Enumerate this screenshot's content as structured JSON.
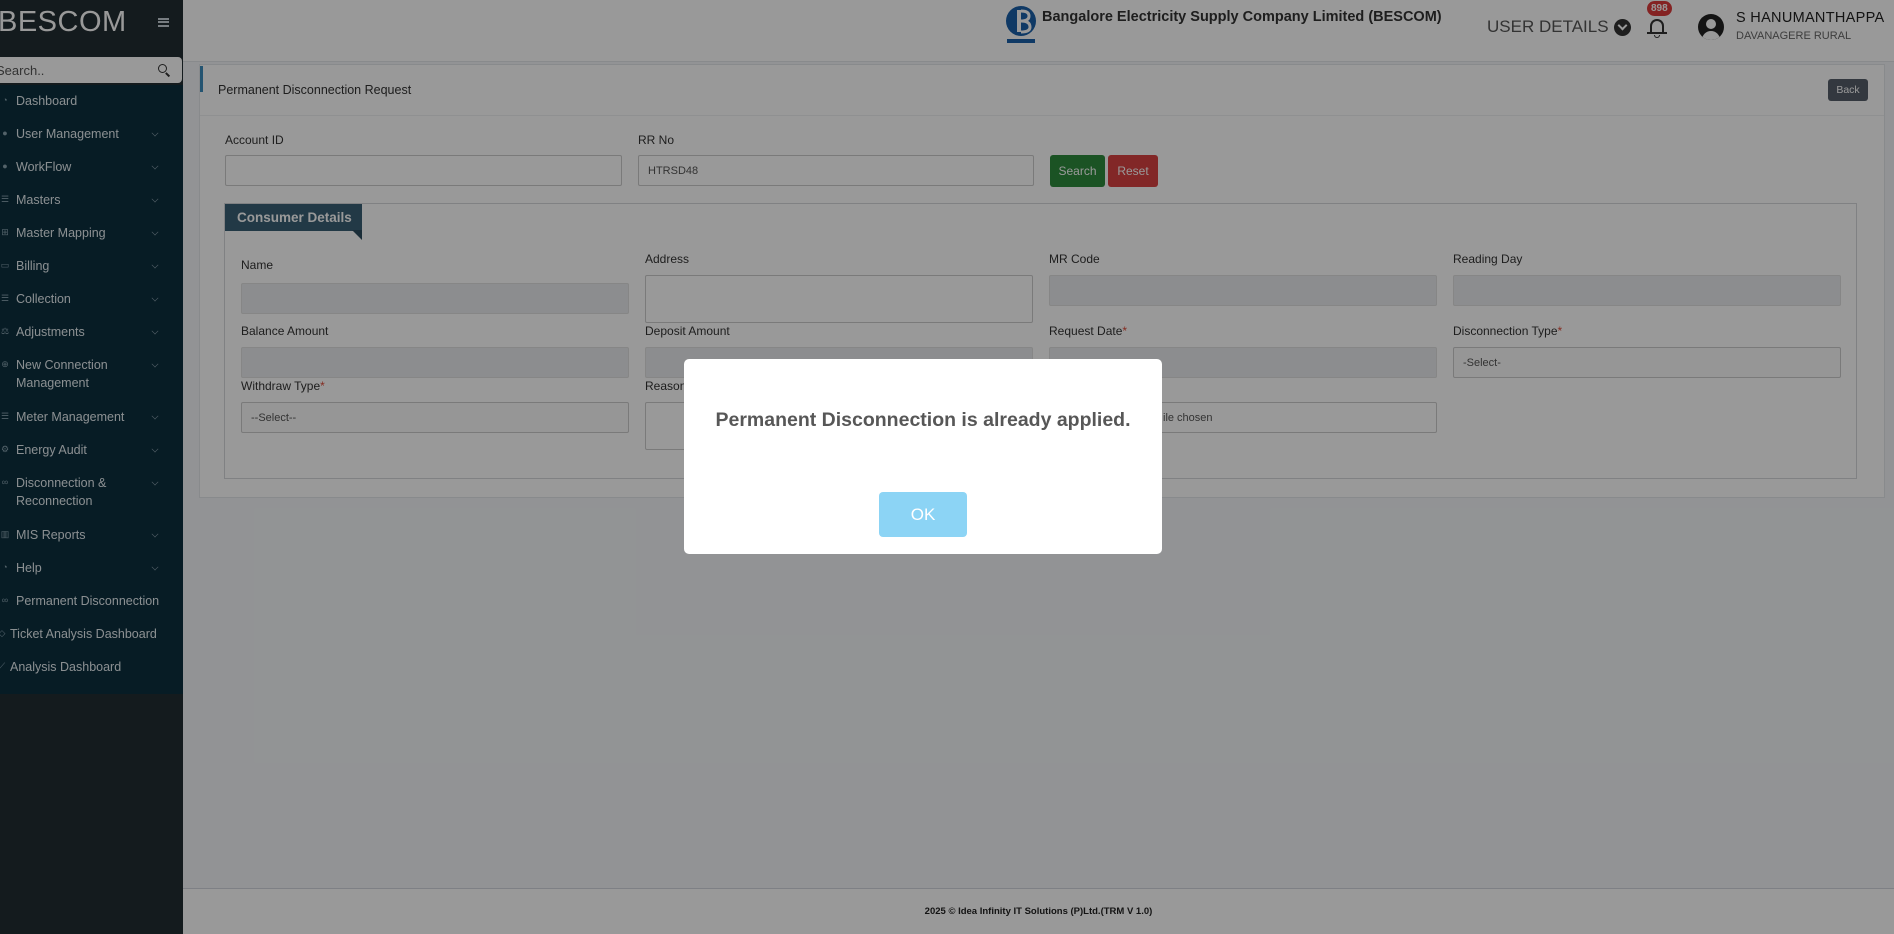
{
  "brand": {
    "title": "BESCOM"
  },
  "sidebar": {
    "search_placeholder": "Search..",
    "items": [
      {
        "label": "Dashboard",
        "icon": "dashboard-icon",
        "has_children": false
      },
      {
        "label": "User Management",
        "icon": "user-icon",
        "has_children": true
      },
      {
        "label": "WorkFlow",
        "icon": "user-icon",
        "has_children": true
      },
      {
        "label": "Masters",
        "icon": "list-icon",
        "has_children": true
      },
      {
        "label": "Master Mapping",
        "icon": "sitemap-icon",
        "has_children": true
      },
      {
        "label": "Billing",
        "icon": "monitor-icon",
        "has_children": true
      },
      {
        "label": "Collection",
        "icon": "list-icon",
        "has_children": true
      },
      {
        "label": "Adjustments",
        "icon": "balance-icon",
        "has_children": true
      },
      {
        "label": "New Connection Management",
        "icon": "plus-circle-icon",
        "has_children": true
      },
      {
        "label": "Meter Management",
        "icon": "list-icon",
        "has_children": true
      },
      {
        "label": "Energy Audit",
        "icon": "cogs-icon",
        "has_children": true
      },
      {
        "label": "Disconnection & Reconnection",
        "icon": "link-icon",
        "has_children": true
      },
      {
        "label": "MIS Reports",
        "icon": "bar-chart-icon",
        "has_children": true
      },
      {
        "label": "Help",
        "icon": "dashboard-icon",
        "has_children": true
      },
      {
        "label": "Permanent Disconnection",
        "icon": "link-icon",
        "has_children": false
      },
      {
        "label": "Ticket Analysis Dashboard",
        "icon": "ticket-icon",
        "has_children": false
      },
      {
        "label": "Analysis Dashboard",
        "icon": "line-chart-icon",
        "has_children": false
      }
    ]
  },
  "header": {
    "company": "Bangalore Electricity Supply Company Limited (BESCOM)",
    "user_details_label": "USER DETAILS",
    "notification_count": "898",
    "user_name": "S HANUMANTHAPPA",
    "user_region": "DAVANAGERE RURAL"
  },
  "page": {
    "title": "Permanent Disconnection Request",
    "back_label": "Back",
    "search_form": {
      "account_id_label": "Account ID",
      "account_id_value": "",
      "rr_no_label": "RR No",
      "rr_no_value": "HTRSD48",
      "search_label": "Search",
      "reset_label": "Reset"
    },
    "consumer_details": {
      "legend": "Consumer Details",
      "name_label": "Name",
      "address_label": "Address",
      "mr_code_label": "MR Code",
      "reading_day_label": "Reading Day",
      "balance_amount_label": "Balance Amount",
      "deposit_amount_label": "Deposit Amount",
      "request_date_label": "Request Date",
      "disconnection_type_label": "Disconnection Type",
      "disconnection_type_value": "-Select-",
      "withdraw_type_label": "Withdraw Type",
      "withdraw_type_value": "--Select--",
      "reason_label": "Reason",
      "file_status": "ile chosen",
      "required_mark": "*"
    }
  },
  "modal": {
    "message": "Permanent Disconnection is already applied.",
    "ok_label": "OK"
  },
  "footer": {
    "text": "2025 © Idea Infinity IT Solutions (P)Ltd.(TRM V 1.0)"
  },
  "colors": {
    "sidebar_bg": "#0c2f3f",
    "search_btn": "#2e8b3d",
    "reset_btn": "#d94141",
    "ok_btn": "#8cd4f5",
    "badge": "#dd3b3b"
  }
}
